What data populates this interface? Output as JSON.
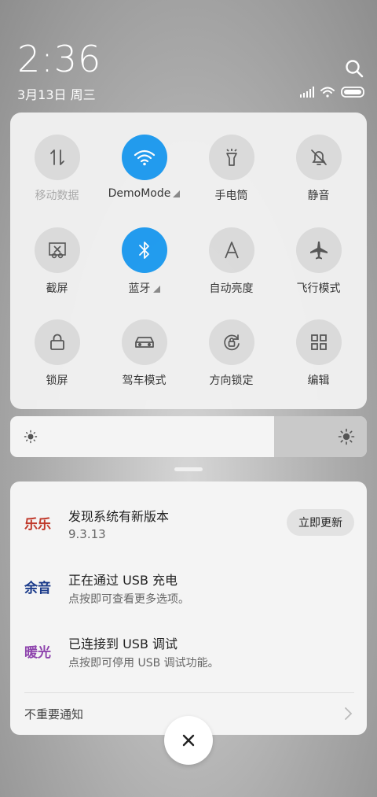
{
  "status": {
    "time": "2:36",
    "date": "3月13日 周三"
  },
  "quick_settings": {
    "tiles": [
      {
        "label": "移动数据",
        "icon": "mobile-data-icon",
        "active": false,
        "dim": true
      },
      {
        "label": "DemoMode",
        "icon": "wifi-icon",
        "active": true,
        "expand": true
      },
      {
        "label": "手电筒",
        "icon": "flashlight-icon",
        "active": false
      },
      {
        "label": "静音",
        "icon": "bell-off-icon",
        "active": false
      },
      {
        "label": "截屏",
        "icon": "screenshot-icon",
        "active": false
      },
      {
        "label": "蓝牙",
        "icon": "bluetooth-icon",
        "active": true,
        "expand": true
      },
      {
        "label": "自动亮度",
        "icon": "auto-brightness-icon",
        "active": false
      },
      {
        "label": "飞行模式",
        "icon": "airplane-icon",
        "active": false
      },
      {
        "label": "锁屏",
        "icon": "lock-icon",
        "active": false
      },
      {
        "label": "驾车模式",
        "icon": "car-icon",
        "active": false
      },
      {
        "label": "方向锁定",
        "icon": "rotation-lock-icon",
        "active": false
      },
      {
        "label": "编辑",
        "icon": "grid-icon",
        "active": false
      }
    ],
    "active_color": "#1e9bf0"
  },
  "brightness": {
    "level": 0.74
  },
  "notifications": {
    "items": [
      {
        "app_text": "乐乐",
        "title": "发现系统有新版本",
        "subtitle": "9.3.13",
        "action": "立即更新"
      },
      {
        "app_text": "余音",
        "title": "正在通过 USB 充电",
        "subtitle": "点按即可查看更多选项。"
      },
      {
        "app_text": "暖光",
        "title": "已连接到 USB 调试",
        "subtitle": "点按即可停用 USB 调试功能。"
      }
    ],
    "unimportant": "不重要通知"
  }
}
